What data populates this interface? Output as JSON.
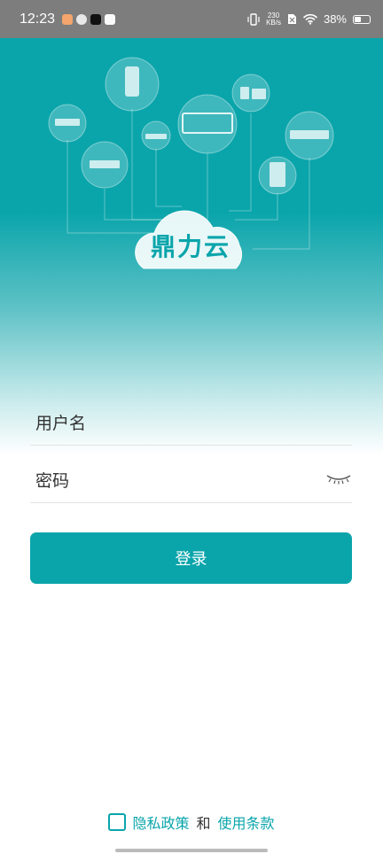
{
  "status_bar": {
    "time": "12:23",
    "net_speed_value": "230",
    "net_speed_unit": "KB/s",
    "battery": "38%"
  },
  "brand": {
    "logo_text": "鼎力云",
    "color": "#0aa5ab"
  },
  "form": {
    "username_label": "用户名",
    "password_label": "密码",
    "login_label": "登录"
  },
  "agreement": {
    "privacy_label": "隐私政策",
    "and_label": "和",
    "terms_label": "使用条款"
  },
  "icons": [
    "eye-closed-icon",
    "checkbox-icon",
    "wifi-icon",
    "vibrate-icon",
    "battery-icon"
  ]
}
